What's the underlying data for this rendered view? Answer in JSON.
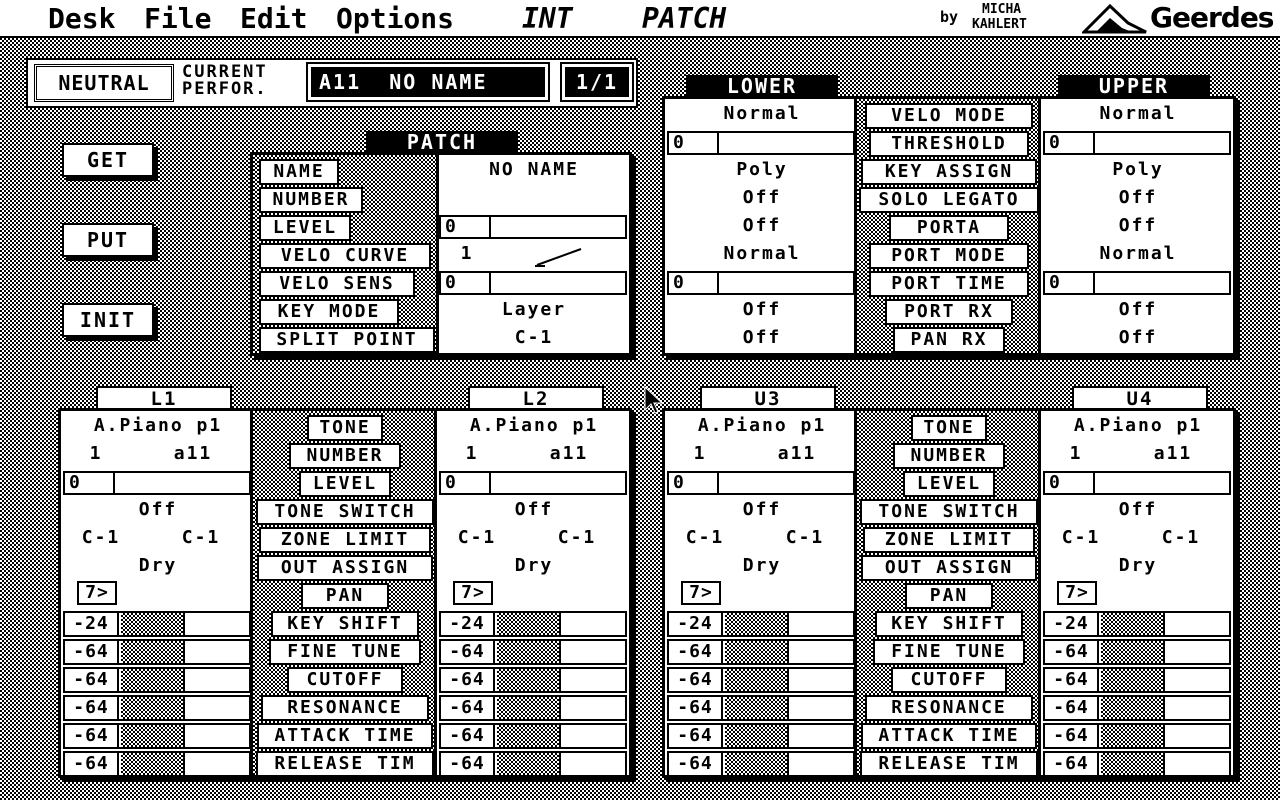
{
  "menubar": {
    "items": [
      "Desk",
      "File",
      "Edit",
      "Options"
    ],
    "status1": "INT",
    "status2": "PATCH",
    "credit_by": "by",
    "credit_name1": "MICHA",
    "credit_name2": "KAHLERT",
    "logo_text": "Geerdes"
  },
  "perf": {
    "neutral": "NEUTRAL",
    "current1": "CURRENT",
    "current2": "PERFOR.",
    "name": "A11  NO NAME",
    "page": "1/1"
  },
  "buttons": {
    "get": "GET",
    "put": "PUT",
    "init": "INIT"
  },
  "patch": {
    "title": "PATCH",
    "labels": [
      "NAME",
      "NUMBER",
      "LEVEL",
      "VELO CURVE",
      "VELO SENS",
      "KEY MODE",
      "SPLIT POINT"
    ],
    "name": "NO NAME",
    "level": "0",
    "velo_curve": "1",
    "velo_sens": "0",
    "key_mode": "Layer",
    "split_point": "C-1"
  },
  "keyboard": {
    "lower_title": "LOWER",
    "upper_title": "UPPER",
    "labels": [
      "VELO MODE",
      "THRESHOLD",
      "KEY ASSIGN",
      "SOLO LEGATO",
      "PORTA",
      "PORT MODE",
      "PORT TIME",
      "PORT RX",
      "PAN RX"
    ],
    "lower": {
      "velo_mode": "Normal",
      "threshold": "0",
      "key_assign": "Poly",
      "solo_legato": "Off",
      "porta": "Off",
      "port_mode": "Normal",
      "port_time": "0",
      "port_rx": "Off",
      "pan_rx": "Off"
    },
    "upper": {
      "velo_mode": "Normal",
      "threshold": "0",
      "key_assign": "Poly",
      "solo_legato": "Off",
      "porta": "Off",
      "port_mode": "Normal",
      "port_time": "0",
      "port_rx": "Off",
      "pan_rx": "Off"
    }
  },
  "tone_labels": [
    "TONE",
    "NUMBER",
    "LEVEL",
    "TONE SWITCH",
    "ZONE LIMIT",
    "OUT ASSIGN",
    "PAN",
    "KEY SHIFT",
    "FINE TUNE",
    "CUTOFF",
    "RESONANCE",
    "ATTACK TIME",
    "RELEASE TIM"
  ],
  "parts": [
    {
      "title": "L1",
      "tone": "A.Piano p1",
      "number": "1",
      "number2": "a11",
      "level": "0",
      "switch": "Off",
      "zone_lo": "C-1",
      "zone_hi": "C-1",
      "out": "Dry",
      "pan": "7>",
      "values": [
        "-24",
        "-64",
        "-64",
        "-64",
        "-64",
        "-64"
      ]
    },
    {
      "title": "L2",
      "tone": "A.Piano p1",
      "number": "1",
      "number2": "a11",
      "level": "0",
      "switch": "Off",
      "zone_lo": "C-1",
      "zone_hi": "C-1",
      "out": "Dry",
      "pan": "7>",
      "values": [
        "-24",
        "-64",
        "-64",
        "-64",
        "-64",
        "-64"
      ]
    },
    {
      "title": "U3",
      "tone": "A.Piano p1",
      "number": "1",
      "number2": "a11",
      "level": "0",
      "switch": "Off",
      "zone_lo": "C-1",
      "zone_hi": "C-1",
      "out": "Dry",
      "pan": "7>",
      "values": [
        "-24",
        "-64",
        "-64",
        "-64",
        "-64",
        "-64"
      ]
    },
    {
      "title": "U4",
      "tone": "A.Piano p1",
      "number": "1",
      "number2": "a11",
      "level": "0",
      "switch": "Off",
      "zone_lo": "C-1",
      "zone_hi": "C-1",
      "out": "Dry",
      "pan": "7>",
      "values": [
        "-24",
        "-64",
        "-64",
        "-64",
        "-64",
        "-64"
      ]
    }
  ]
}
